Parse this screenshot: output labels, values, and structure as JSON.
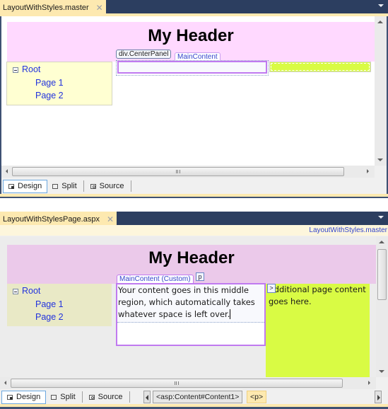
{
  "top": {
    "tab_label": "LayoutWithStyles.master",
    "header_text": "My Header",
    "nav": {
      "root": "Root",
      "items": [
        "Page 1",
        "Page 2"
      ]
    },
    "tag_centerpanel": "div.CenterPanel",
    "tag_maincontent": "MainContent",
    "viewbar": {
      "design": "Design",
      "split": "Split",
      "source": "Source"
    }
  },
  "bottom": {
    "tab_label": "LayoutWithStylesPage.aspx",
    "master_link": "LayoutWithStyles.master",
    "header_text": "My Header",
    "nav": {
      "root": "Root",
      "items": [
        "Page 1",
        "Page 2"
      ]
    },
    "tag_maincontent": "MainContent (Custom)",
    "tag_p": "p",
    "content_text": "Your content goes in this middle region, which automatically takes whatever space is left over.",
    "right_text": "Additional page content goes here.",
    "right_marker": ">",
    "viewbar": {
      "design": "Design",
      "split": "Split",
      "source": "Source"
    },
    "breadcrumb": [
      "<asp:Content#Content1>",
      "<p>"
    ]
  },
  "colors": {
    "header_pink": "#ffd9ff",
    "header_pink_dim": "#ebc9ea",
    "nav_yellow": "#ffffd2",
    "nav_yellow_dim": "#e9e9c6",
    "right_lime": "#d9fb44",
    "tab_active": "#fde9b0",
    "tabstrip": "#2c3e60",
    "link_blue": "#2233dd",
    "tag_purple": "#b070ee"
  }
}
